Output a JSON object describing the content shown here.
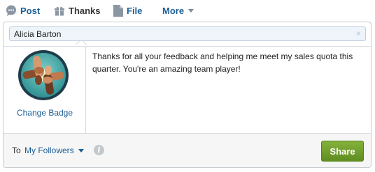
{
  "tabs": {
    "post": {
      "label": "Post",
      "icon": "speech-bubble-icon"
    },
    "thanks": {
      "label": "Thanks",
      "icon": "gift-icon"
    },
    "file": {
      "label": "File",
      "icon": "document-icon"
    },
    "more": {
      "label": "More",
      "icon": "chevron-down-icon"
    }
  },
  "recipient": {
    "name": "Alicia Barton",
    "clear_glyph": "×"
  },
  "badge": {
    "icon": "teamwork-hands-badge-icon",
    "change_label": "Change Badge"
  },
  "message": "Thanks for all your feedback and helping me meet my sales quota this quarter. You're an amazing team player!",
  "footer": {
    "to_label": "To",
    "audience": "My Followers",
    "info_glyph": "i",
    "share_label": "Share"
  },
  "colors": {
    "link": "#1a5f97",
    "share_button": "#6c9a25",
    "recipient_bg": "#eef4fa"
  }
}
